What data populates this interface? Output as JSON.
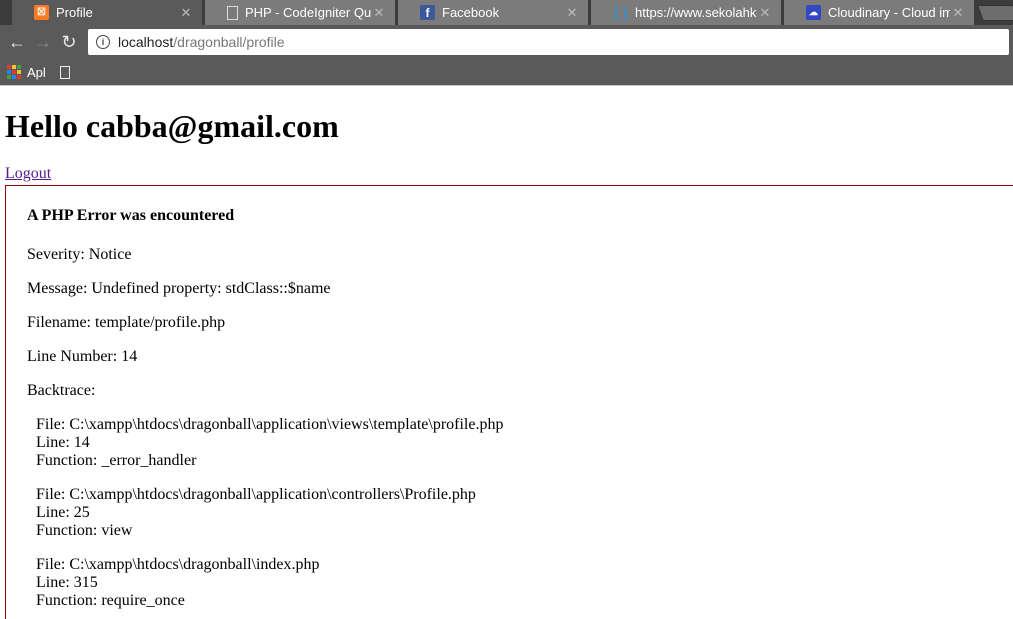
{
  "browser": {
    "tabs": [
      {
        "title": "Profile",
        "icon": "xampp-icon",
        "active": true
      },
      {
        "title": "PHP - CodeIgniter Query",
        "icon": "page-icon",
        "active": false
      },
      {
        "title": "Facebook",
        "icon": "facebook-icon",
        "active": false
      },
      {
        "title": "https://www.sekolahkodi",
        "icon": "brackets-icon",
        "active": false
      },
      {
        "title": "Cloudinary - Cloud image",
        "icon": "cloudinary-icon",
        "active": false
      }
    ],
    "close_glyph": "✕",
    "address": {
      "host": "localhost",
      "path": "/dragonball/profile"
    },
    "bookmarks": {
      "apps_label": "Apl"
    }
  },
  "page": {
    "heading": "Hello cabba@gmail.com",
    "logout_label": "Logout",
    "error": {
      "title": "A PHP Error was encountered",
      "severity": "Severity: Notice",
      "message": "Message: Undefined property: stdClass::$name",
      "filename": "Filename: template/profile.php",
      "line_number": "Line Number: 14",
      "backtrace_label": "Backtrace:",
      "backtrace": [
        {
          "file": "File: C:\\xampp\\htdocs\\dragonball\\application\\views\\template\\profile.php",
          "line": "Line: 14",
          "function": "Function: _error_handler"
        },
        {
          "file": "File: C:\\xampp\\htdocs\\dragonball\\application\\controllers\\Profile.php",
          "line": "Line: 25",
          "function": "Function: view"
        },
        {
          "file": "File: C:\\xampp\\htdocs\\dragonball\\index.php",
          "line": "Line: 315",
          "function": "Function: require_once"
        }
      ]
    }
  },
  "colors": {
    "error_border": "#990000",
    "link_visited": "#551a8b",
    "xampp": "#fb7a24",
    "facebook": "#3b5998",
    "cloudinary": "#3448c5"
  }
}
